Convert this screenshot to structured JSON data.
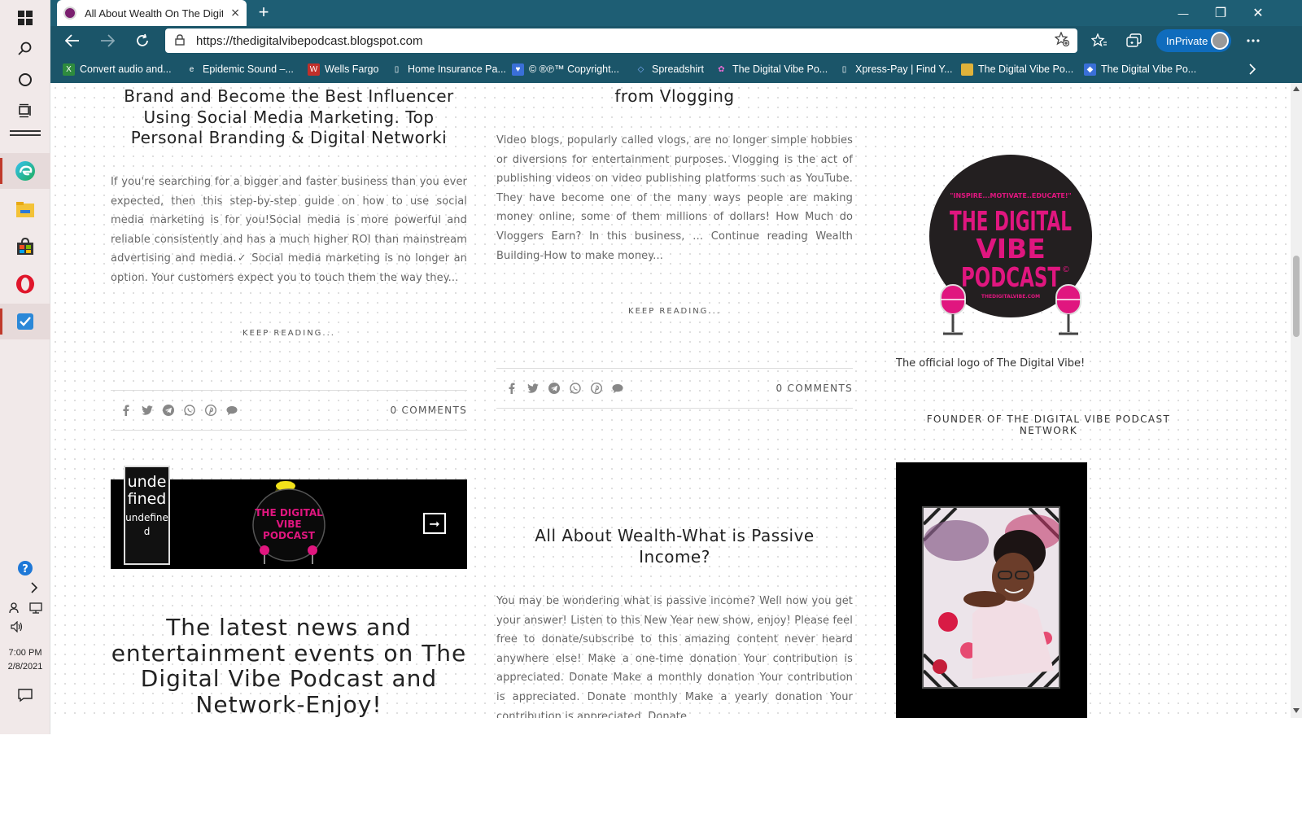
{
  "taskbar": {
    "clock_time": "7:00 PM",
    "clock_date": "2/8/2021"
  },
  "tab": {
    "title": "All About Wealth On The Digital",
    "close": "×",
    "new_tab": "+"
  },
  "window_controls": {
    "minimize": "—",
    "restore": "❐",
    "close": "✕"
  },
  "address": {
    "url": "https://thedigitalvibepodcast.blogspot.com",
    "inprivate_label": "InPrivate"
  },
  "bookmarks": [
    {
      "label": "Convert audio and...",
      "color": "#2e8b3e",
      "glyph": "X"
    },
    {
      "label": "Epidemic Sound –...",
      "color": "#1b5569",
      "glyph": "e"
    },
    {
      "label": "Wells Fargo",
      "color": "#c0302b",
      "glyph": "W"
    },
    {
      "label": "Home Insurance Pa...",
      "color": "#1b5569",
      "glyph": "▯"
    },
    {
      "label": "© ®℗™ Copyright...",
      "color": "#3a6fd8",
      "glyph": "♥"
    },
    {
      "label": "Spreadshirt",
      "color": "#1b5569",
      "glyph": "◇"
    },
    {
      "label": "The Digital Vibe Po...",
      "color": "#6a2a7a",
      "glyph": "✿"
    },
    {
      "label": "Xpress-Pay | Find Y...",
      "color": "#1b5569",
      "glyph": "▯"
    },
    {
      "label": "The Digital Vibe Po...",
      "color": "#e0b23a",
      "glyph": "▬"
    },
    {
      "label": "The Digital Vibe Po...",
      "color": "#3a6fd8",
      "glyph": "◆"
    }
  ],
  "posts": {
    "left": {
      "title": "Brand and Become the Best Influencer Using Social Media Marketing. Top Personal Branding & Digital Networki",
      "excerpt": " If you're searching for a bigger and faster business than you ever expected, then this step-by-step guide on how to use social media marketing is for you!Social media is more powerful and reliable consistently and has a much higher ROI than mainstream advertising and media.✓ Social media marketing is no longer an option. Your customers expect you to touch them the way they...",
      "keep_reading": "KEEP READING...",
      "comments": "0 COMMENTS"
    },
    "middle": {
      "title": "from Vlogging",
      "excerpt": "Video blogs, popularly called vlogs, are no longer simple hobbies or diversions for entertainment purposes. Vlogging is the act of publishing videos on video publishing platforms such as YouTube. They have become one of the many ways people are making money online, some of them millions of dollars! How Much do Vloggers Earn? In this business, … Continue reading Wealth Building-How to make money...",
      "keep_reading": "KEEP READING...",
      "comments": "0 COMMENTS"
    },
    "passive": {
      "title": "All About Wealth-What is Passive Income?",
      "excerpt": "You may be wondering what is passive income? Well now you get your answer! Listen to this New Year new show, enjoy! Please feel free to donate/subscribe to this amazing content never heard anywhere else! Make a one-time donation Your contribution is appreciated. Donate Make a monthly donation Your contribution is appreciated. Donate monthly Make a yearly donation Your contribution is appreciated. Donate"
    },
    "latest": {
      "title": "The latest news and entertainment events on The Digital Vibe Podcast and Network-Enjoy!"
    }
  },
  "slider": {
    "label_big": "undefined",
    "label_small": "undefined",
    "arrow": "➞"
  },
  "logo": {
    "tagline": "\"INSPIRE...MOTIVATE..EDUCATE!\"",
    "line1": "THE DIGITAL",
    "line2": "VIBE",
    "line3": "PODCAST",
    "mark": "©",
    "domain": "THEDIGITALVIBE.COM"
  },
  "slide_logo": {
    "line1": "THE DIGITAL",
    "line2": "VIBE",
    "line3": "PODCAST"
  },
  "sidebar": {
    "logo_caption": "The official logo of The Digital Vibe!",
    "founder_heading": "FOUNDER OF THE DIGITAL VIBE PODCAST NETWORK"
  },
  "colors": {
    "browser_chrome": "#1b5569",
    "titlebar": "#1e5e74",
    "logo_pink": "#e0167f",
    "accent_blue": "#0f6cbd"
  }
}
